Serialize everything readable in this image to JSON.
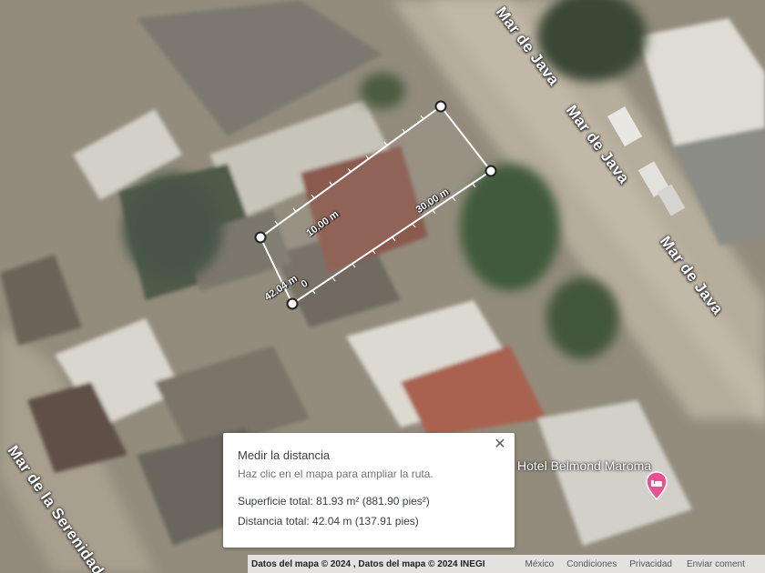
{
  "map": {
    "type": "satellite",
    "streets": [
      {
        "name": "Mar de Java"
      },
      {
        "name": "Mar de Java"
      },
      {
        "name": "Mar de Java"
      },
      {
        "name": "Mar de la Serenidad"
      }
    ],
    "poi": {
      "name": "Hotel Belmond Maroma",
      "icon": "hotel-bed-icon",
      "pin_color": "#e8538f"
    },
    "measurement": {
      "segment_labels": [
        "10.00 m",
        "30.00 m",
        "42.04 m",
        "0"
      ],
      "line_color": "#ffffff"
    }
  },
  "info_card": {
    "title": "Medir la distancia",
    "hint": "Haz clic en el mapa para ampliar la ruta.",
    "area": "Superficie total: 81.93 m² (881.90 pies²)",
    "distance": "Distancia total: 42.04 m (137.91 pies)",
    "close_icon": "close-icon"
  },
  "footer": {
    "attribution": "Datos del mapa © 2024 , Datos del mapa © 2024 INEGI",
    "links": [
      "México",
      "Condiciones",
      "Privacidad"
    ],
    "tail": "Enviar coment"
  }
}
